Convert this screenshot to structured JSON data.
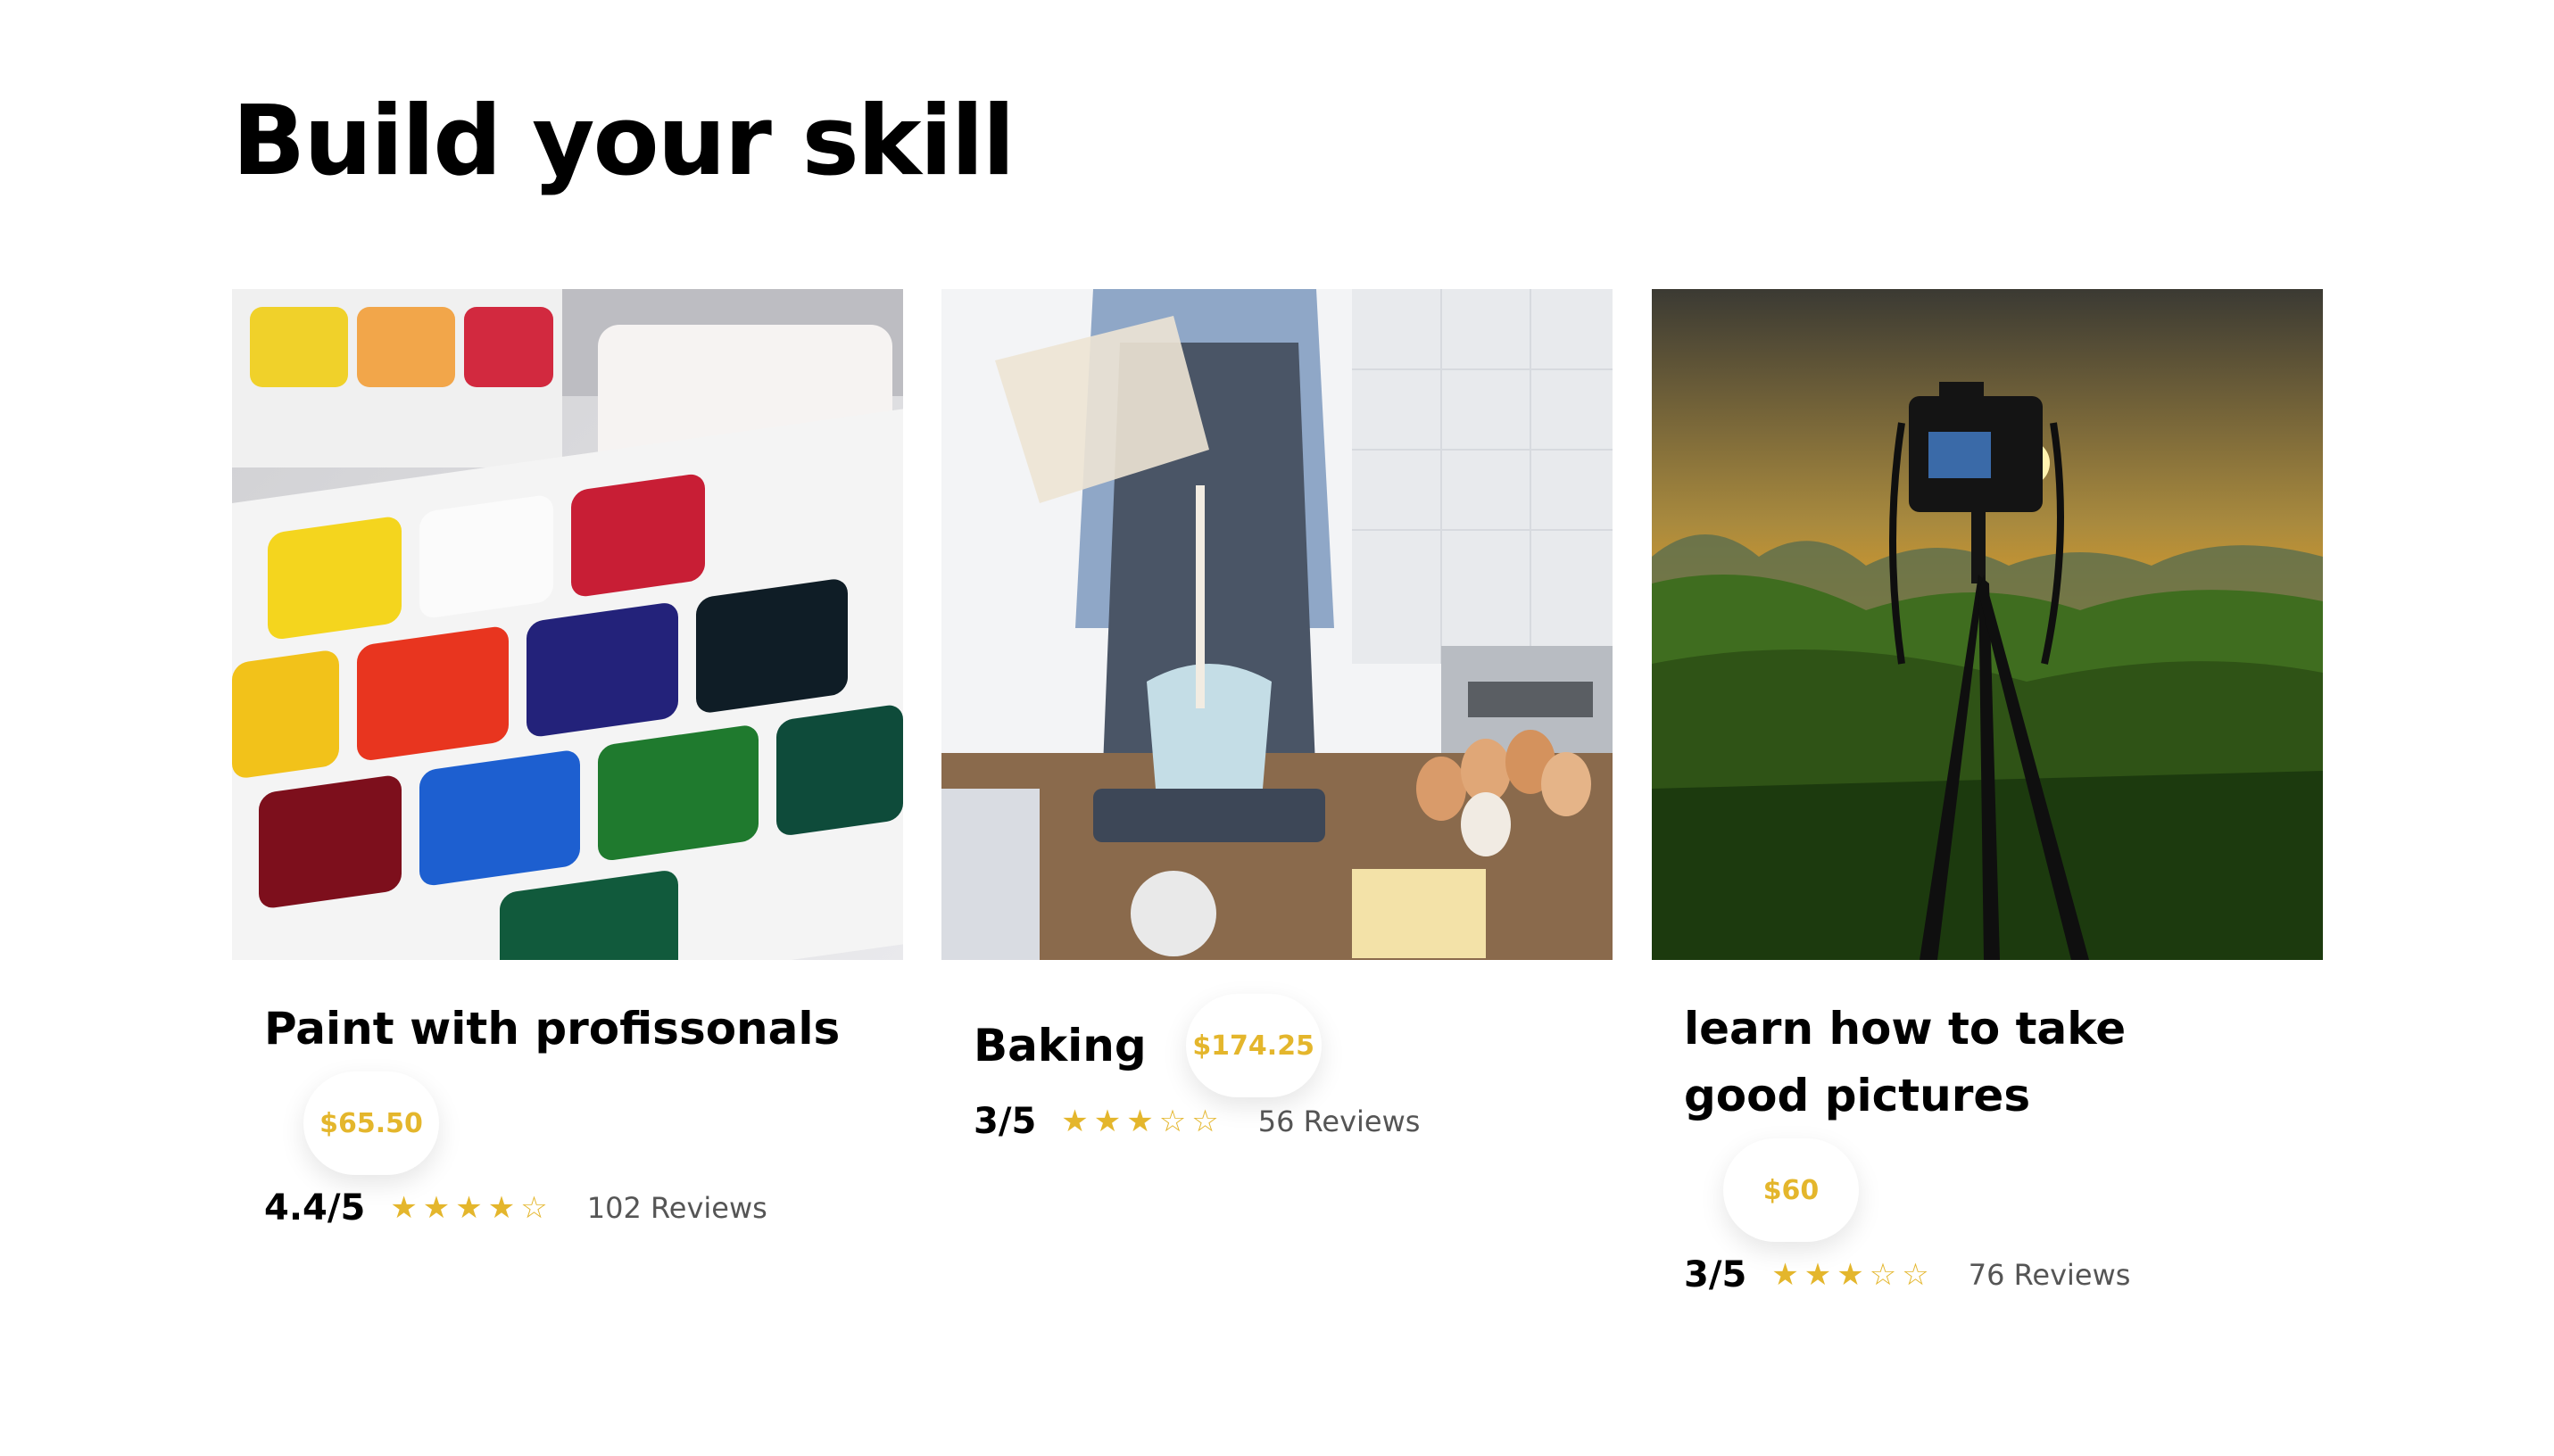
{
  "heading": "Build your skill",
  "colors": {
    "accent": "#e4b62c",
    "text": "#000000",
    "muted": "#555555",
    "background": "#ffffff"
  },
  "cards": [
    {
      "image": "watercolor-paint-palette",
      "title": "Paint with profissonals",
      "price": "$65.50",
      "score": "4.4/5",
      "stars": [
        "star-filled",
        "star-filled",
        "star-filled",
        "star-filled",
        "star-outline"
      ],
      "reviews": "102 Reviews"
    },
    {
      "image": "baking-pouring-flour",
      "title": "Baking",
      "price": "$174.25",
      "score": "3/5",
      "stars": [
        "star-filled",
        "star-filled",
        "star-filled",
        "star-outline",
        "star-outline"
      ],
      "reviews": "56 Reviews"
    },
    {
      "image": "camera-tripod-sunset",
      "title": "learn how to take good pictures",
      "price": "$60",
      "score": "3/5",
      "stars": [
        "star-filled",
        "star-filled",
        "star-filled",
        "star-outline",
        "star-outline"
      ],
      "reviews": "76 Reviews"
    }
  ]
}
